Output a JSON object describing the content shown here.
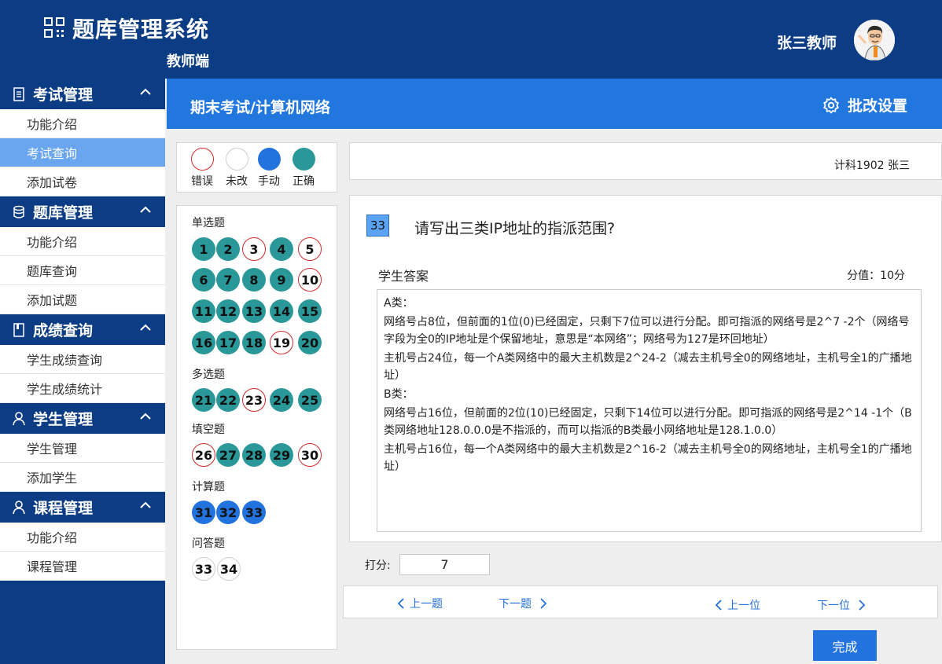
{
  "header": {
    "title": "题库管理系统",
    "subtitle": "教师端",
    "user": "张三教师"
  },
  "sidebar": {
    "groups": [
      {
        "label": "考试管理",
        "items": [
          "功能介绍",
          "考试查询",
          "添加试卷"
        ]
      },
      {
        "label": "题库管理",
        "items": [
          "功能介绍",
          "题库查询",
          "添加试题"
        ]
      },
      {
        "label": "成绩查询",
        "items": [
          "学生成绩查询",
          "学生成绩统计"
        ]
      },
      {
        "label": "学生管理",
        "items": [
          "学生管理",
          "添加学生"
        ]
      },
      {
        "label": "课程管理",
        "items": [
          "功能介绍",
          "课程管理"
        ]
      }
    ],
    "active": "考试查询"
  },
  "breadcrumb": "期末考试/计算机网络",
  "settings_label": "批改设置",
  "legend": {
    "wrong": "错误",
    "unmarked": "未改",
    "manual": "手动",
    "correct": "正确"
  },
  "question_nav": {
    "categories": [
      "单选题",
      "多选题",
      "填空题",
      "计算题",
      "问答题"
    ],
    "single": [
      "1",
      "2",
      "3",
      "4",
      "5",
      "6",
      "7",
      "8",
      "9",
      "10",
      "11",
      "12",
      "13",
      "14",
      "15",
      "16",
      "17",
      "18",
      "19",
      "20"
    ],
    "multi": [
      "21",
      "22",
      "23",
      "24",
      "25"
    ],
    "fill": [
      "26",
      "27",
      "28",
      "29",
      "30"
    ],
    "calc": [
      "31",
      "32",
      "33"
    ],
    "essay": [
      "33",
      "34"
    ]
  },
  "student_info": "计科1902 张三",
  "question": {
    "number": "33",
    "text": "请写出三类IP地址的指派范围?",
    "answer_label": "学生答案",
    "score_label": "分值：10分",
    "answer_lines": [
      "A类：",
      "网络号占8位，但前面的1位(0)已经固定，只剩下7位可以进行分配。即可指派的网络号是2^7 -2个（网络号字段为全0的IP地址是个保留地址，意思是“本网络”；网络号为127是环回地址）",
      "主机号占24位，每一个A类网络中的最大主机数是2^24-2（减去主机号全0的网络地址，主机号全1的广播地址）",
      "B类：",
      "网络号占16位，但前面的2位(10)已经固定，只剩下14位可以进行分配。即可指派的网络号是2^14 -1个（B类网络地址128.0.0.0是不指派的，而可以指派的B类最小网络地址是128.1.0.0）",
      "主机号占16位，每一个A类网络中的最大主机数是2^16-2（减去主机号全0的网络地址，主机号全1的广播地址）"
    ]
  },
  "grading": {
    "label": "打分:",
    "value": "7"
  },
  "nav": {
    "prev_question": "上一题",
    "next_question": "下一题",
    "prev_student": "上一位",
    "next_student": "下一位"
  },
  "done_label": "完成"
}
